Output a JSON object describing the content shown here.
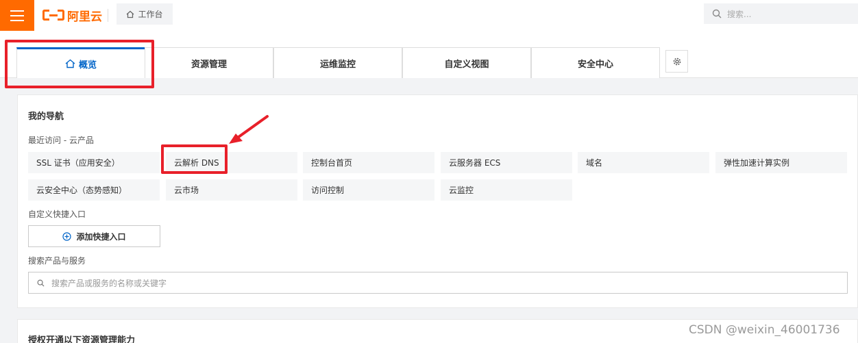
{
  "topbar": {
    "logo_text": "阿里云",
    "workbench_label": "工作台",
    "search_placeholder": "搜索..."
  },
  "tabs": [
    {
      "label": "概览",
      "active": true
    },
    {
      "label": "资源管理"
    },
    {
      "label": "运维监控"
    },
    {
      "label": "自定义视图"
    },
    {
      "label": "安全中心"
    }
  ],
  "nav": {
    "title": "我的导航",
    "recent_label": "最近访问 - 云产品",
    "recent_items": [
      "SSL 证书（应用安全）",
      "云解析 DNS",
      "控制台首页",
      "云服务器 ECS",
      "域名",
      "弹性加速计算实例",
      "云安全中心（态势感知）",
      "云市场",
      "访问控制",
      "云监控"
    ],
    "custom_label": "自定义快捷入口",
    "add_shortcut_label": "添加快捷入口",
    "search_label": "搜索产品与服务",
    "search_placeholder": "搜索产品或服务的名称或关键字"
  },
  "auth": {
    "title": "授权开通以下资源管理能力"
  },
  "watermark": "CSDN @weixin_46001736",
  "colors": {
    "brand": "#ff6a00",
    "accent": "#0064c8",
    "highlight": "#e8202a"
  }
}
